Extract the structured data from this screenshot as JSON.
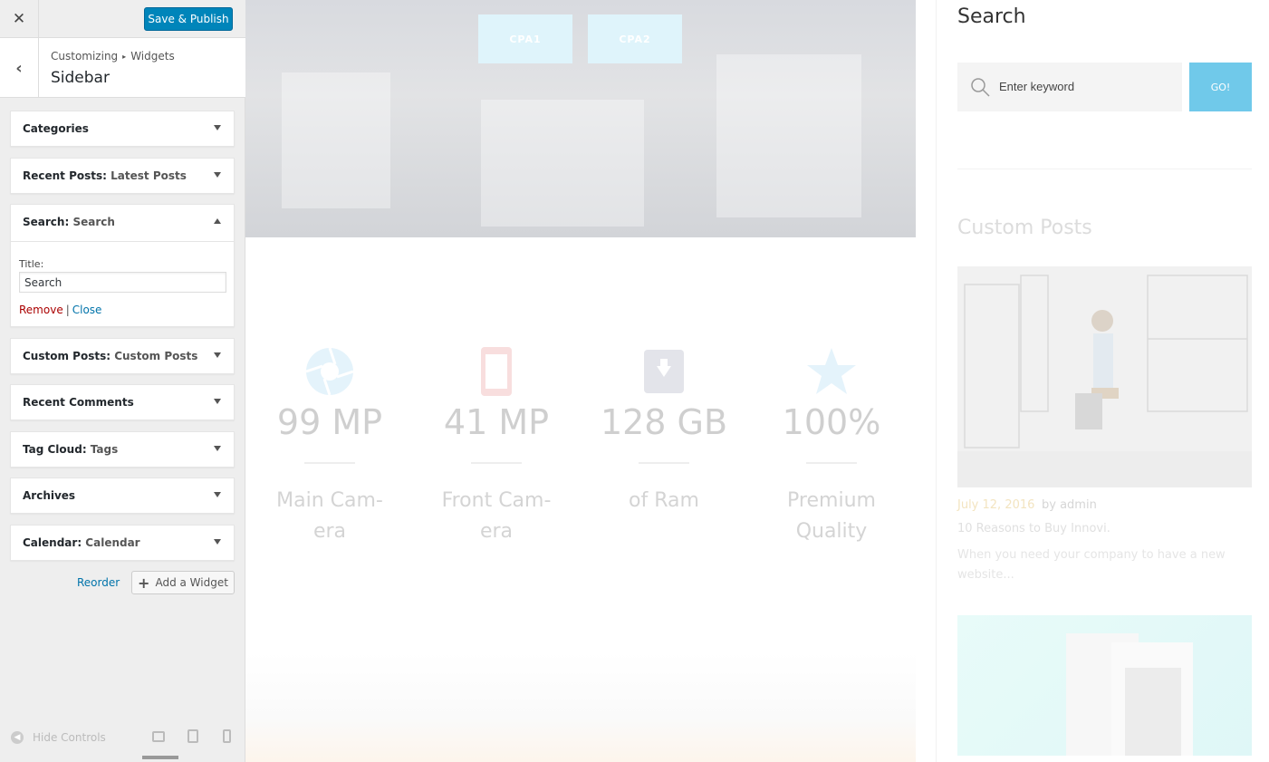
{
  "customizer": {
    "close_icon": "close-icon",
    "save_label": "Save & Publish",
    "breadcrumb": {
      "root": "Customizing",
      "current": "Widgets"
    },
    "section_title": "Sidebar",
    "widgets": [
      {
        "name": "Categories",
        "subtitle": ""
      },
      {
        "name": "Recent Posts",
        "subtitle": "Latest Posts"
      },
      {
        "name": "Search",
        "subtitle": "Search"
      },
      {
        "name": "Custom Posts",
        "subtitle": "Custom Posts"
      },
      {
        "name": "Recent Comments",
        "subtitle": ""
      },
      {
        "name": "Tag Cloud",
        "subtitle": "Tags"
      },
      {
        "name": "Archives",
        "subtitle": ""
      },
      {
        "name": "Calendar",
        "subtitle": "Calendar"
      }
    ],
    "search_form": {
      "title_label": "Title:",
      "title_value": "Search",
      "remove": "Remove",
      "separator": "|",
      "close": "Close"
    },
    "reorder": "Reorder",
    "add_widget": "Add a Widget",
    "hide_controls": "Hide Controls"
  },
  "preview": {
    "cpa_buttons": [
      "CPA1",
      "CPA2"
    ],
    "stats": [
      {
        "value": "99 MP",
        "desc1": "Main Cam-",
        "desc2": "era",
        "icon": "aperture-icon"
      },
      {
        "value": "41 MP",
        "desc1": "Front Cam-",
        "desc2": "era",
        "icon": "phone-icon"
      },
      {
        "value": "128 GB",
        "desc1": "of Ram",
        "desc2": "",
        "icon": "archive-icon"
      },
      {
        "value": "100%",
        "desc1": "Premium",
        "desc2": "Quality",
        "icon": "star-icon"
      }
    ],
    "side": {
      "search_title": "Search",
      "search_placeholder": "Enter keyword",
      "go": "GO!",
      "custom_posts_title": "Custom Posts",
      "post_date": "July 12, 2016",
      "post_by": "by admin",
      "post_title": "10 Reasons to Buy Innovi.",
      "post_excerpt": "When you need your company to have a new website..."
    }
  }
}
